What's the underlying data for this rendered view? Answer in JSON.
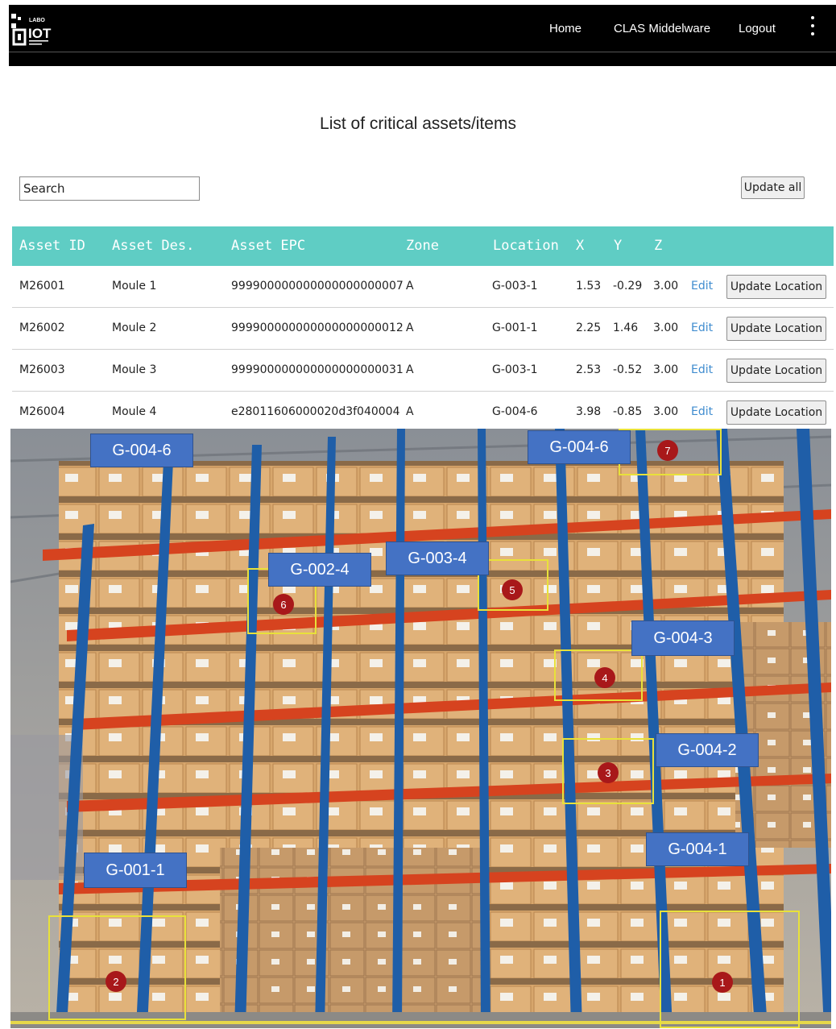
{
  "header": {
    "logo_text": "IOT",
    "logo_prefix": "LABO",
    "nav": [
      {
        "label": "Home"
      },
      {
        "label": "CLAS Middelware"
      },
      {
        "label": "Logout"
      }
    ]
  },
  "page": {
    "title": "List of critical assets/items",
    "search_placeholder": "Search",
    "update_all_label": "Update all"
  },
  "table": {
    "headers": [
      "Asset ID",
      "Asset Des.",
      "Asset EPC",
      "Zone",
      "Location",
      "X",
      "Y",
      "Z"
    ],
    "edit_label": "Edit",
    "update_location_label": "Update Location",
    "rows": [
      {
        "id": "M26001",
        "des": "Moule 1",
        "epc": "999900000000000000000007",
        "zone": "A",
        "location": "G-003-1",
        "x": "1.53",
        "y": "-0.29",
        "z": "3.00"
      },
      {
        "id": "M26002",
        "des": "Moule 2",
        "epc": "999900000000000000000012",
        "zone": "A",
        "location": "G-001-1",
        "x": "2.25",
        "y": "1.46",
        "z": "3.00"
      },
      {
        "id": "M26003",
        "des": "Moule 3",
        "epc": "999900000000000000000031",
        "zone": "A",
        "location": "G-003-1",
        "x": "2.53",
        "y": "-0.52",
        "z": "3.00"
      },
      {
        "id": "M26004",
        "des": "Moule 4",
        "epc": "e28011606000020d3f040004",
        "zone": "A",
        "location": "G-004-6",
        "x": "3.98",
        "y": "-0.85",
        "z": "3.00"
      }
    ]
  },
  "warehouse": {
    "labels": [
      "G-004-6",
      "G-004-6",
      "G-002-4",
      "G-003-4",
      "G-004-3",
      "G-004-2",
      "G-004-1",
      "G-001-1"
    ],
    "markers": [
      "7",
      "6",
      "5",
      "4",
      "3",
      "2",
      "1"
    ]
  },
  "colors": {
    "header_bg": "#000000",
    "table_header_bg": "#5fcdc4",
    "link": "#3f8ccf",
    "label_bg": "#4472c4",
    "marker_bg": "#a8181a",
    "outline": "#e8e13a"
  }
}
